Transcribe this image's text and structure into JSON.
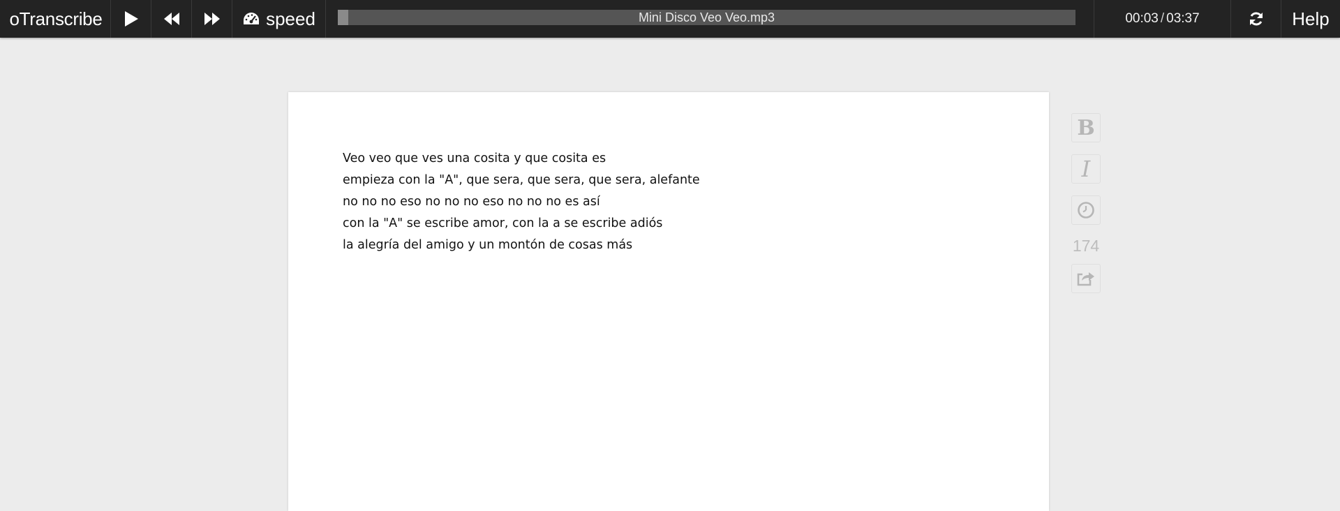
{
  "app": {
    "brand": "oTranscribe",
    "colors": {
      "toolbar_bg": "#232323",
      "page_bg": "#ececec",
      "progress_track": "#555555",
      "progress_fill": "#8a8a8a"
    }
  },
  "toolbar": {
    "play_icon": "play-icon",
    "rewind_icon": "rewind-icon",
    "fast_forward_icon": "fast-forward-icon",
    "speed_icon": "speedometer-icon",
    "speed_label": "speed",
    "track_title": "Mini Disco Veo Veo.mp3",
    "progress_fraction": 0.014,
    "current_time": "00:03",
    "time_separator": "/",
    "total_time": "03:37",
    "refresh_icon": "refresh-icon",
    "help_label": "Help"
  },
  "document": {
    "lines": [
      "Veo veo que ves una cosita y que cosita es",
      "empieza con la \"A\", que sera, que sera, que sera, alefante",
      "no no no eso no no no eso no no no es así",
      "con la \"A\" se escribe amor, con la a se escribe adiós",
      "la alegría del amigo y un montón de cosas más"
    ]
  },
  "sidebar": {
    "bold_label": "B",
    "italic_label": "I",
    "timestamp_icon": "clock-icon",
    "word_count": "174",
    "export_icon": "export-share-icon"
  }
}
